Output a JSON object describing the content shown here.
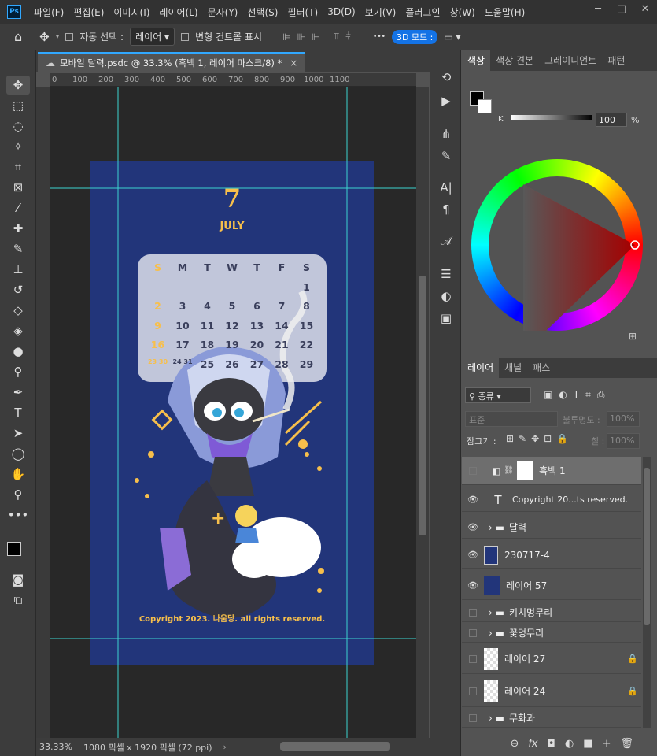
{
  "menu": {
    "logo": "Ps",
    "items": [
      "파일(F)",
      "편집(E)",
      "이미지(I)",
      "레이어(L)",
      "문자(Y)",
      "선택(S)",
      "필터(T)",
      "3D(D)",
      "보기(V)",
      "플러그인",
      "창(W)",
      "도움말(H)"
    ],
    "controls": [
      "─",
      "□",
      "✕"
    ]
  },
  "options": {
    "home": "⌂",
    "move": "✥",
    "autoselect": "자동 선택 :",
    "select_value": "레이어",
    "transform": "변형 컨트롤 표시",
    "mode3d": "3D 모드 :",
    "more": "•••"
  },
  "doc": {
    "tab_title": "모바일 달력.psdc @ 33.3% (흑백 1, 레이어 마스크/8) *",
    "close": "×",
    "cloud": "☁"
  },
  "ruler": {
    "ticks": [
      "0",
      "100",
      "200",
      "300",
      "400",
      "500",
      "600",
      "700",
      "800",
      "900",
      "1000",
      "1100"
    ]
  },
  "status": {
    "zoom": "33.33%",
    "info": "1080 픽셀 x 1920 픽셀 (72 ppi)"
  },
  "poster": {
    "month_num": "7",
    "month_name": "JULY",
    "days": [
      "S",
      "M",
      "T",
      "W",
      "T",
      "F",
      "S"
    ],
    "dates": [
      "",
      "",
      "",
      "",
      "",
      "",
      "1",
      "2",
      "3",
      "4",
      "5",
      "6",
      "7",
      "8",
      "9",
      "10",
      "11",
      "12",
      "13",
      "14",
      "15",
      "16",
      "17",
      "18",
      "19",
      "20",
      "21",
      "22",
      "23 30",
      "24 31",
      "25",
      "26",
      "27",
      "28",
      "29"
    ],
    "copyright": "Copyright 2023. 나움당. all rights reserved."
  },
  "colors": {
    "bg": "#22357a",
    "accent": "#f7bf4b",
    "guide": "#3cd3d0",
    "psblue": "#31a8ff"
  },
  "color_panel": {
    "tabs": [
      "색상",
      "색상 견본",
      "그레이디언트",
      "패턴"
    ],
    "channel": "K",
    "value": "100",
    "unit": "%"
  },
  "layers_panel": {
    "tabs": [
      "레이어",
      "채널",
      "패스"
    ],
    "filter": "종류",
    "blend": "표준",
    "opacity_label": "불투명도 :",
    "opacity": "100%",
    "lock_label": "잠그기 :",
    "fill_label": "칠 :",
    "fill": "100%",
    "layers": [
      {
        "name": "흑백 1",
        "visible": false
      },
      {
        "name": "Copyright 20...ts reserved.",
        "visible": true
      },
      {
        "name": "달력",
        "visible": true
      },
      {
        "name": "230717-4",
        "visible": true
      },
      {
        "name": "레이어 57",
        "visible": true
      },
      {
        "name": "키치멍무리",
        "visible": false
      },
      {
        "name": "꽃멍무리",
        "visible": false
      },
      {
        "name": "레이어 27",
        "visible": false
      },
      {
        "name": "레이어 24",
        "visible": false
      },
      {
        "name": "무화과",
        "visible": false
      }
    ],
    "bottom": [
      "⊖",
      "fx",
      "◘",
      "◐",
      "■",
      "+",
      "🗑"
    ]
  }
}
